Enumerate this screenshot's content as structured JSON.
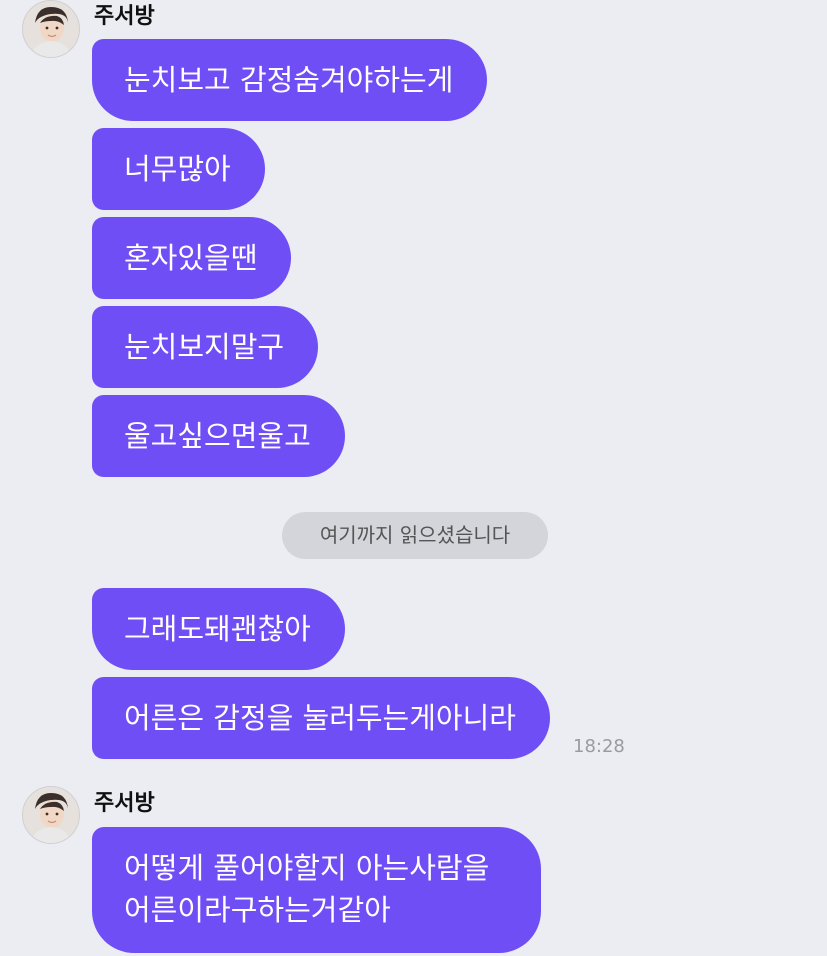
{
  "messages": [
    {
      "sender": "주서방",
      "bubbles": [
        "눈치보고 감정숨겨야하는게",
        "너무많아",
        "혼자있을땐",
        "눈치보지말구",
        "울고싶으면울고"
      ]
    },
    {
      "bubbles": [
        "그래도돼괜찮아",
        "어른은 감정을 눌러두는게아니라"
      ],
      "time": "18:28"
    },
    {
      "sender": "주서방",
      "bubbles": [
        "어떻게 풀어야할지 아는사람을 어른이라구하는거같아"
      ]
    }
  ],
  "divider": "여기까지 읽으셨습니다",
  "colors": {
    "bubble": "#6f4ef5",
    "background": "#ecedf2",
    "divider_bg": "#d4d5da"
  }
}
